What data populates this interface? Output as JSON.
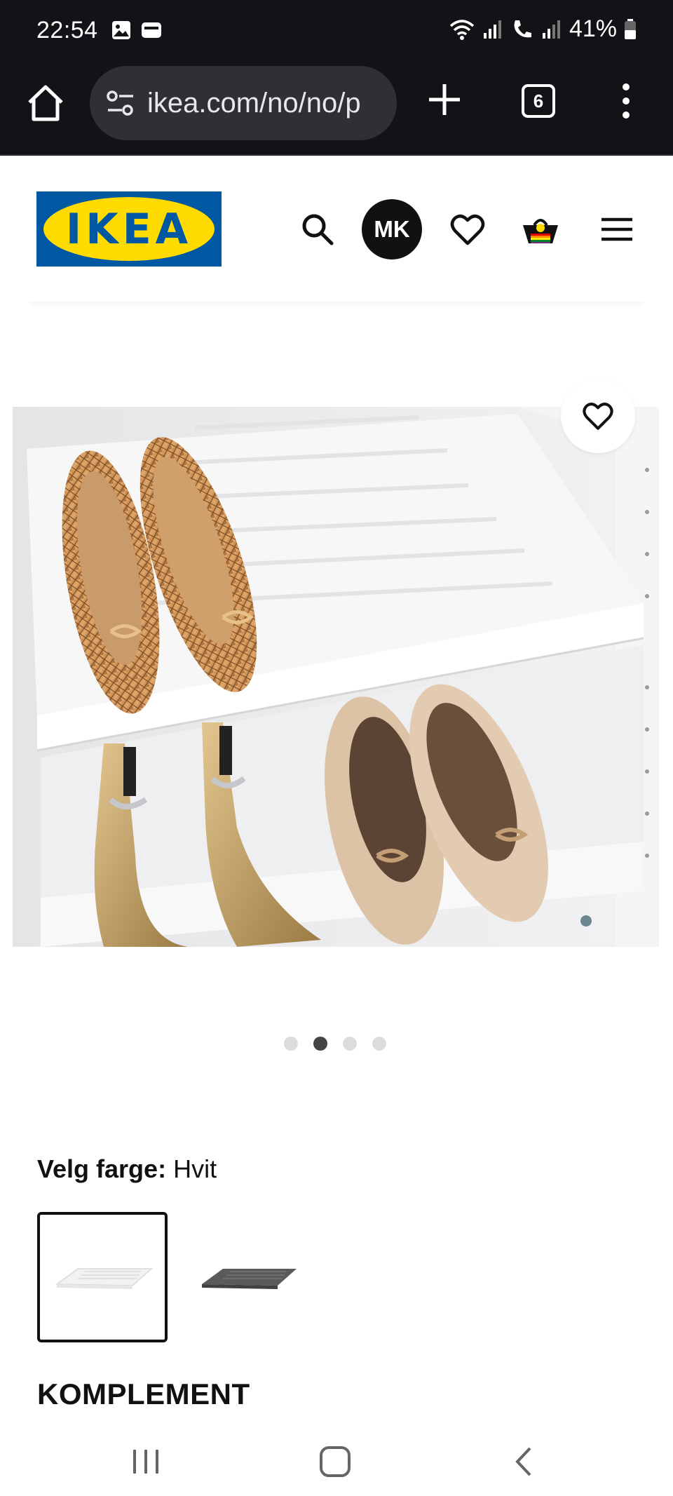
{
  "status_bar": {
    "time": "22:54",
    "battery": "41%",
    "icons": [
      "gallery-icon",
      "wallet-icon",
      "wifi-icon",
      "signal-icon",
      "call-icon",
      "signal-icon",
      "battery-icon"
    ]
  },
  "browser": {
    "url": "ikea.com/no/no/p",
    "tab_count": "6",
    "icons": [
      "home-icon",
      "site-settings-icon",
      "new-tab-icon",
      "tabs-icon",
      "overflow-menu-icon"
    ]
  },
  "header": {
    "logo_text": "IKEA",
    "avatar_initials": "MK",
    "icons": [
      "search-icon",
      "heart-icon",
      "cart-icon",
      "menu-icon"
    ],
    "brand_colors": {
      "blue": "#0058A3",
      "yellow": "#FFDB00"
    }
  },
  "product_gallery": {
    "dots_total": 4,
    "active_dot": 2
  },
  "color_selection": {
    "label": "Velg farge:",
    "value": "Hvit",
    "swatches": [
      {
        "name": "Hvit",
        "selected": true,
        "color": "#f4f4f4"
      },
      {
        "name": "Mørk grå",
        "selected": false,
        "color": "#5a5a5c"
      }
    ]
  },
  "section_title": "KOMPLEMENT",
  "navigation_bar": {
    "icons": [
      "recents-icon",
      "home-button-icon",
      "back-icon"
    ]
  }
}
